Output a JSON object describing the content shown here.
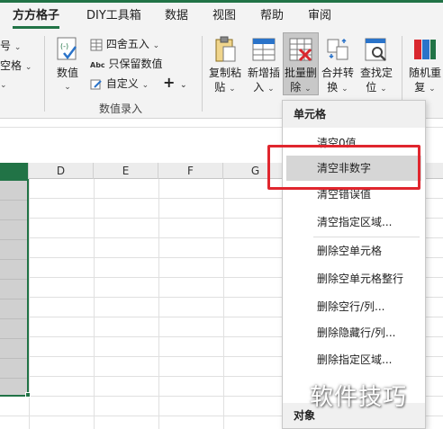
{
  "tabs": [
    {
      "label": "方方格子",
      "active": true
    },
    {
      "label": "DIY工具箱",
      "active": false
    },
    {
      "label": "数据",
      "active": false
    },
    {
      "label": "视图",
      "active": false
    },
    {
      "label": "帮助",
      "active": false
    },
    {
      "label": "审阅",
      "active": false
    }
  ],
  "ribbon": {
    "left_partial": [
      "号",
      "空格"
    ],
    "number_group": {
      "value_button": "数值",
      "round_label": "四舍五入",
      "keep_value_label": "只保留数值",
      "custom_label": "自定义",
      "plus_label": "+",
      "group_label": "数值录入"
    },
    "buttons": [
      {
        "line1": "复制粘",
        "line2": "贴"
      },
      {
        "line1": "新增插",
        "line2": "入"
      },
      {
        "line1": "批量删",
        "line2": "除"
      },
      {
        "line1": "合并转",
        "line2": "换"
      },
      {
        "line1": "查找定",
        "line2": "位"
      },
      {
        "line1": "随机重",
        "line2": "复"
      }
    ]
  },
  "grid": {
    "columns": [
      "D",
      "E",
      "F",
      "G"
    ]
  },
  "menu": {
    "header": "单元格",
    "items": [
      "清空0值",
      "清空非数字",
      "清空错误值",
      "清空指定区域...",
      "删除空单元格",
      "删除空单元格整行",
      "删除空行/列...",
      "删除隐藏行/列...",
      "删除指定区域..."
    ],
    "hover_item": "清空非数字",
    "footer_header": "对象"
  },
  "watermark": "软件技巧",
  "colors": {
    "accent": "#217346",
    "highlight": "#e0262e",
    "ribbon_bg": "#f3f3f3"
  }
}
